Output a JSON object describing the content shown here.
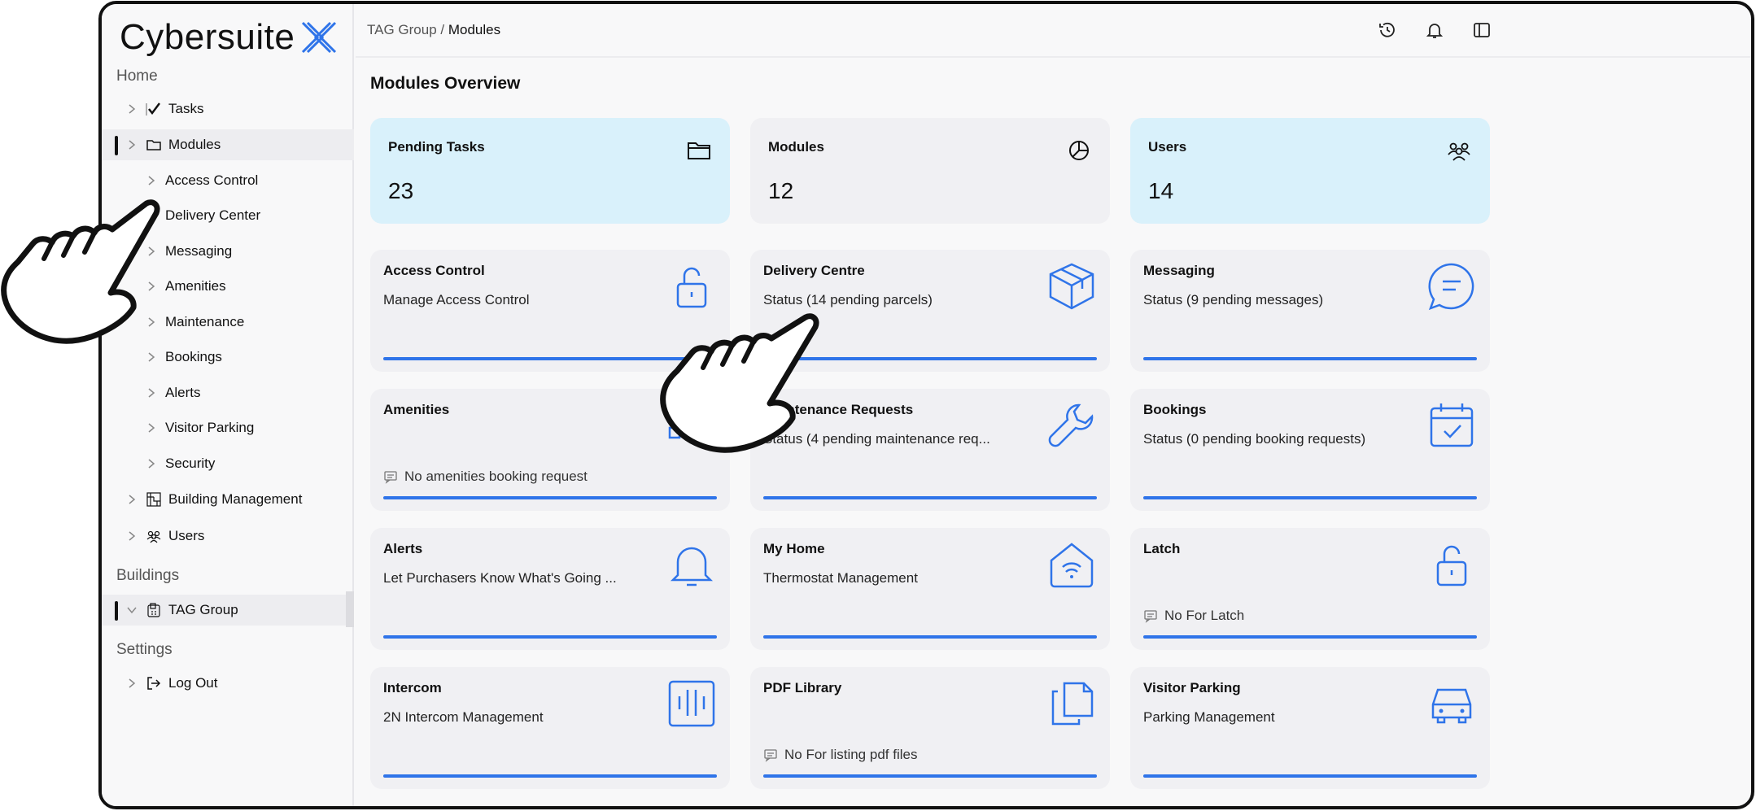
{
  "brand": {
    "name": "Cybersuite"
  },
  "sidebar": {
    "sections": {
      "home": "Home",
      "buildings": "Buildings",
      "settings": "Settings"
    },
    "items": [
      {
        "label": "Tasks"
      },
      {
        "label": "Modules"
      },
      {
        "label": "Access Control"
      },
      {
        "label": "Delivery Center"
      },
      {
        "label": "Messaging"
      },
      {
        "label": "Amenities"
      },
      {
        "label": "Maintenance"
      },
      {
        "label": "Bookings"
      },
      {
        "label": "Alerts"
      },
      {
        "label": "Visitor Parking"
      },
      {
        "label": "Security"
      },
      {
        "label": "Building Management"
      },
      {
        "label": "Users"
      }
    ],
    "building": {
      "label": "TAG Group"
    },
    "logout": {
      "label": "Log Out"
    }
  },
  "breadcrumb": {
    "root": "TAG Group",
    "sep": "/",
    "current": "Modules"
  },
  "page": {
    "title": "Modules Overview"
  },
  "stats": [
    {
      "label": "Pending Tasks",
      "value": "23",
      "icon": "folder-icon"
    },
    {
      "label": "Modules",
      "value": "12",
      "icon": "pie-chart-icon"
    },
    {
      "label": "Users",
      "value": "14",
      "icon": "users-icon"
    }
  ],
  "modules": [
    {
      "title": "Access Control",
      "subtitle": "Manage Access Control",
      "note": "",
      "icon": "lock-open-icon"
    },
    {
      "title": "Delivery Centre",
      "subtitle": "Status (14 pending parcels)",
      "note": "",
      "icon": "package-icon"
    },
    {
      "title": "Messaging",
      "subtitle": "Status (9 pending messages)",
      "note": "",
      "icon": "message-icon"
    },
    {
      "title": "Amenities",
      "subtitle": "",
      "note": "No amenities booking request",
      "icon": "amenities-icon"
    },
    {
      "title": "Maintenance Requests",
      "subtitle": "Status (4 pending maintenance req...",
      "note": "",
      "icon": "wrench-icon"
    },
    {
      "title": "Bookings",
      "subtitle": "Status (0 pending booking requests)",
      "note": "",
      "icon": "calendar-check-icon"
    },
    {
      "title": "Alerts",
      "subtitle": "Let Purchasers Know What's Going ...",
      "note": "",
      "icon": "bell-icon"
    },
    {
      "title": "My Home",
      "subtitle": "Thermostat Management",
      "note": "",
      "icon": "home-wifi-icon"
    },
    {
      "title": "Latch",
      "subtitle": "",
      "note": "No For Latch",
      "icon": "lock-open-icon"
    },
    {
      "title": "Intercom",
      "subtitle": "2N Intercom Management",
      "note": "",
      "icon": "intercom-icon"
    },
    {
      "title": "PDF Library",
      "subtitle": "",
      "note": "No For listing pdf files",
      "icon": "files-icon"
    },
    {
      "title": "Visitor Parking",
      "subtitle": "Parking Management",
      "note": "",
      "icon": "car-icon"
    }
  ],
  "colors": {
    "accent": "#2f74e9",
    "stat_highlight": "#d9f1fb",
    "card_bg": "#f0f0f3"
  }
}
